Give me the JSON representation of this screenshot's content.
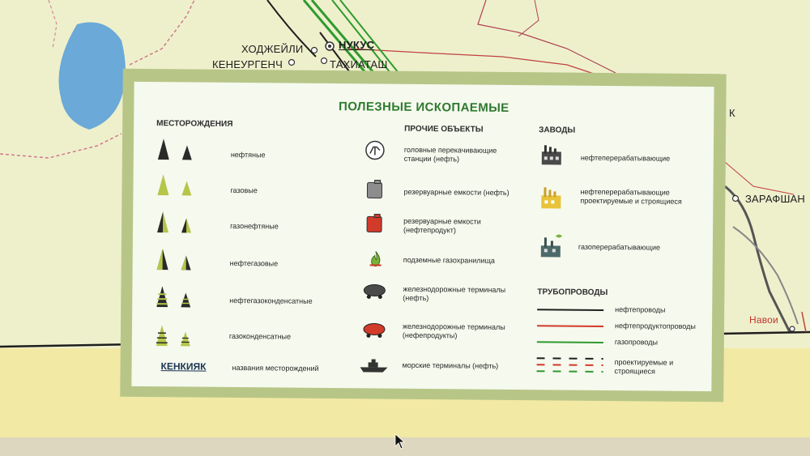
{
  "map": {
    "cities": [
      "ХОДЖЕЙЛИ",
      "НУКУС",
      "КЕНЕУРГЕНЧ",
      "ТАХИАТАШ",
      "ЗАРАФШАН",
      "Навои",
      "К"
    ]
  },
  "legend": {
    "title": "ПОЛЕЗНЫЕ ИСКОПАЕМЫЕ",
    "deposits": {
      "header": "МЕСТОРОЖДЕНИЯ",
      "items": [
        {
          "label": "нефтяные",
          "icon": "oil-deposit-triangle"
        },
        {
          "label": "газовые",
          "icon": "gas-deposit-triangle"
        },
        {
          "label": "газонефтяные",
          "icon": "gas-oil-deposit-triangle"
        },
        {
          "label": "нефтегазовые",
          "icon": "oil-gas-deposit-triangle"
        },
        {
          "label": "нефтегазоконденсатные",
          "icon": "oil-gas-condensate-deposit-triangle"
        },
        {
          "label": "газоконденсатные",
          "icon": "gas-condensate-deposit-triangle"
        }
      ],
      "name_sample": "КЕНКИЯК",
      "name_sample_label": "названия месторождений"
    },
    "other": {
      "header": "ПРОЧИЕ ОБЪЕКТЫ",
      "items": [
        {
          "label": "головные перекачивающие станции (нефть)",
          "icon": "pump-station-icon"
        },
        {
          "label": "резервуарные емкости (нефть)",
          "icon": "oil-tank-icon"
        },
        {
          "label": "резервуарные емкости (нефтепродукт)",
          "icon": "product-tank-icon"
        },
        {
          "label": "подземные газохранилища",
          "icon": "gas-storage-flame-icon"
        },
        {
          "label": "железнодорожные терминалы (нефть)",
          "icon": "rail-tank-oil-icon"
        },
        {
          "label": "железнодорожные терминалы (нефепродукты)",
          "icon": "rail-tank-product-icon"
        },
        {
          "label": "морские терминалы (нефть)",
          "icon": "ship-icon"
        }
      ]
    },
    "plants": {
      "header": "ЗАВОДЫ",
      "items": [
        {
          "label": "нефтеперерабатывающие",
          "icon": "refinery-icon"
        },
        {
          "label": "нефтеперерабатывающие проектируемые и строящиеся",
          "icon": "planned-refinery-icon"
        },
        {
          "label": "газоперерабатывающие",
          "icon": "gas-plant-icon"
        }
      ]
    },
    "pipelines": {
      "header": "ТРУБОПРОВОДЫ",
      "items": [
        {
          "label": "нефтепроводы",
          "color": "#1e1e1e"
        },
        {
          "label": "нефтепродуктопроводы",
          "color": "#d23a2a"
        },
        {
          "label": "газопроводы",
          "color": "#2f9a2f"
        },
        {
          "label": "проектируемые и строящиеся",
          "color": "dashed"
        }
      ]
    }
  },
  "colors": {
    "legend_frame": "#b7c687",
    "title_green": "#2e7a2f",
    "map_bg": "#efeec6",
    "water": "#6aa9d8"
  }
}
